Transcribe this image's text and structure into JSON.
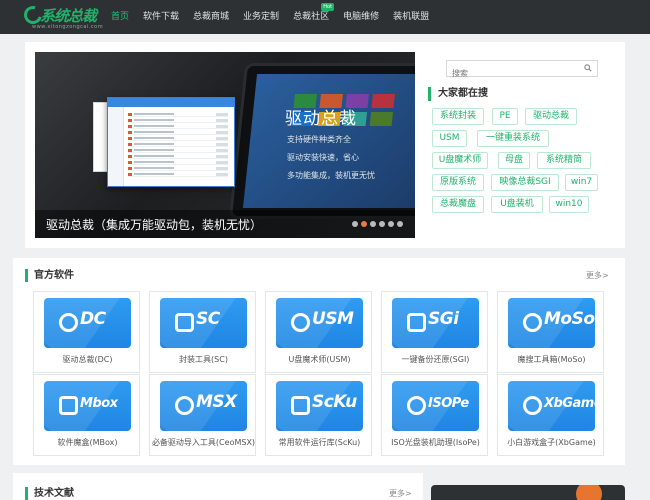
{
  "brand": {
    "name": "系统总裁",
    "url": "www.xitongzongcai.com"
  },
  "nav": [
    {
      "label": "首页",
      "active": true
    },
    {
      "label": "软件下载"
    },
    {
      "label": "总裁商城"
    },
    {
      "label": "业务定制"
    },
    {
      "label": "总裁社区",
      "badge": "Hot"
    },
    {
      "label": "电脑维修"
    },
    {
      "label": "装机联盟"
    }
  ],
  "banner": {
    "title": "驱动总裁",
    "lines": [
      "支持硬件种类齐全",
      "驱动安装快速，省心",
      "多功能集成，装机更无忧"
    ],
    "caption": "驱动总裁（集成万能驱动包，装机无忧）",
    "slide_count": 6,
    "active_slide": 1
  },
  "search": {
    "placeholder": "搜索",
    "icon": "search-icon"
  },
  "hot": {
    "title": "大家都在搜",
    "tags": [
      "系统封装",
      "PE",
      "驱动总裁",
      "USM",
      "一键重装系统",
      "U盘魔术师",
      "母盘",
      "系统精简",
      "原版系统",
      "映像总裁SGI",
      "win7",
      "总裁魔盘",
      "U盘装机",
      "win10"
    ]
  },
  "software": {
    "title": "官方软件",
    "more": "更多>",
    "items": [
      {
        "brand": "DC",
        "label": "驱动总裁(DC)",
        "icon": "gear-icon"
      },
      {
        "brand": "SC",
        "label": "封装工具(SC)",
        "icon": "package-icon"
      },
      {
        "brand": "USM",
        "label": "U盘魔术师(USM)",
        "icon": "usb-icon"
      },
      {
        "brand": "SGi",
        "label": "一键备份还原(SGI)",
        "icon": "restore-icon"
      },
      {
        "brand": "MoSo",
        "label": "魔搜工具箱(MoSo)",
        "icon": "magnifier-icon"
      },
      {
        "brand": "Mbox",
        "label": "软件魔盒(MBox)",
        "icon": "box-icon"
      },
      {
        "brand": "MSX",
        "label": "必备驱动导入工具(CeoMSX)",
        "icon": "chip-icon"
      },
      {
        "brand": "ScKu",
        "label": "常用软件运行库(ScKu)",
        "icon": "code-icon"
      },
      {
        "brand": "ISOPe",
        "label": "ISO光盘装机助理(IsoPe)",
        "icon": "disc-icon"
      },
      {
        "brand": "XbGame",
        "label": "小白游戏盒子(XbGame)",
        "icon": "gamepad-icon"
      }
    ]
  },
  "docs": {
    "title": "技术文献",
    "more": "更多>"
  },
  "colors": {
    "accent": "#20b26b",
    "nav_bg": "#2e3134",
    "tile_blue": "#2792ea",
    "slide_active": "#f07a3a"
  }
}
